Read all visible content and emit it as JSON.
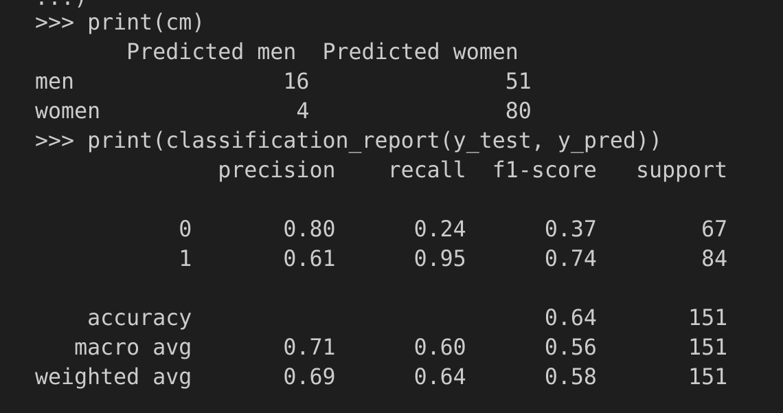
{
  "terminal": {
    "partial_top_line": "...)",
    "lines": [
      ">>> print(cm)",
      "       Predicted men  Predicted women",
      "men                16               51",
      "women               4               80",
      ">>> print(classification_report(y_test, y_pred))",
      "              precision    recall  f1-score   support",
      "",
      "           0       0.80      0.24      0.37        67",
      "           1       0.61      0.95      0.74        84",
      "",
      "    accuracy                           0.64       151",
      "   macro avg       0.71      0.60      0.56       151",
      "weighted avg       0.69      0.64      0.58       151"
    ]
  },
  "colors": {
    "background": "#1e1e1e",
    "text": "#cccccc"
  }
}
